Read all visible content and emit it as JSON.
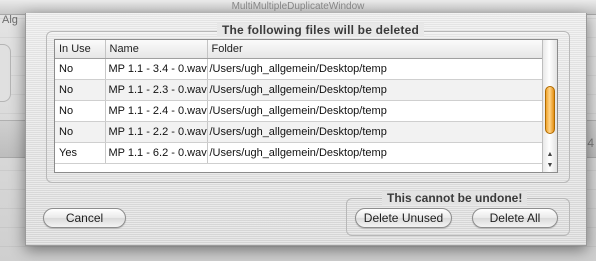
{
  "background": {
    "window_title": "MultiMultipleDuplicateWindow",
    "left_label": "Alg",
    "right_number": "4"
  },
  "dialog": {
    "files_title": "The following files will be deleted",
    "columns": [
      "In Use",
      "Name",
      "Folder"
    ],
    "rows": [
      {
        "in_use": "No",
        "name": "MP 1.1 - 3.4 - 0.wav",
        "folder": "/Users/ugh_allgemein/Desktop/temp"
      },
      {
        "in_use": "No",
        "name": "MP 1.1 - 2.3 - 0.wav",
        "folder": "/Users/ugh_allgemein/Desktop/temp"
      },
      {
        "in_use": "No",
        "name": "MP 1.1 - 2.4 - 0.wav",
        "folder": "/Users/ugh_allgemein/Desktop/temp"
      },
      {
        "in_use": "No",
        "name": "MP 1.1 - 2.2 - 0.wav",
        "folder": "/Users/ugh_allgemein/Desktop/temp"
      },
      {
        "in_use": "Yes",
        "name": "MP 1.1 - 6.2 - 0.wav",
        "folder": "/Users/ugh_allgemein/Desktop/temp"
      }
    ],
    "undone_title": "This cannot be undone!",
    "buttons": {
      "cancel": "Cancel",
      "delete_unused": "Delete Unused",
      "delete_all": "Delete All"
    },
    "accent_color": "#f0a42c"
  }
}
